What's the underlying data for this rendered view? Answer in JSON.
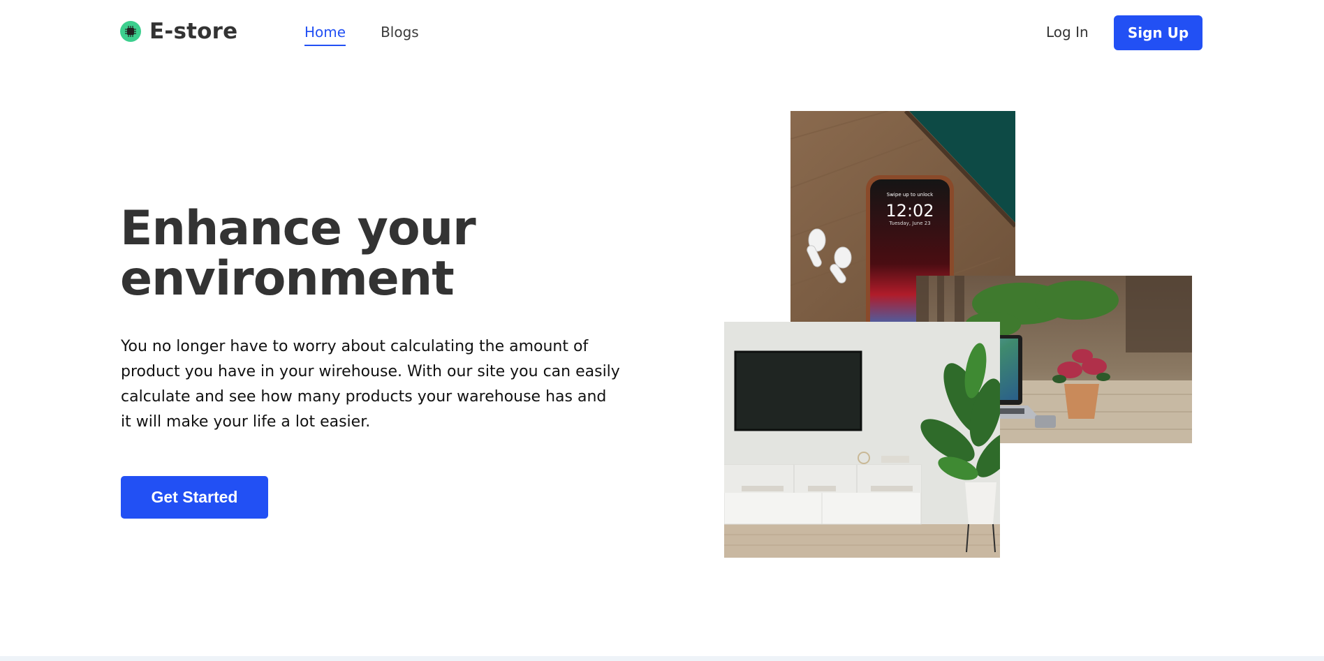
{
  "brand": {
    "name": "E-store",
    "logo_icon": "chip-icon",
    "accent_color": "#3ccf8e"
  },
  "nav": {
    "links": [
      {
        "label": "Home",
        "active": true
      },
      {
        "label": "Blogs",
        "active": false
      }
    ],
    "login_label": "Log In",
    "signup_label": "Sign Up"
  },
  "hero": {
    "title_line1": "Enhance your",
    "title_line2": "environment",
    "description": "You no longer have to worry about calculating the amount of product you have in your wirehouse. With our site you can easily calculate and see how many products your warehouse has and it will make your life a lot easier.",
    "cta_label": "Get Started"
  },
  "images": {
    "phone": {
      "time": "12:02",
      "date": "Tuesday, June 23",
      "lock_text": "Swipe up to unlock"
    }
  },
  "colors": {
    "primary": "#2250f4",
    "heading": "#333333",
    "text": "#111111"
  }
}
